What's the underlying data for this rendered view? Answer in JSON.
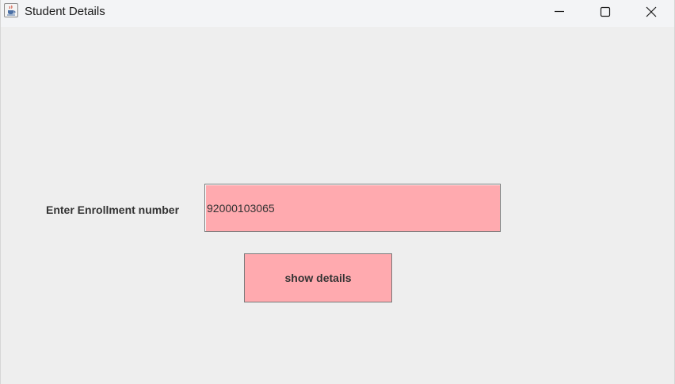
{
  "window": {
    "title": "Student Details",
    "icon": "java-cup-icon",
    "controls": [
      "minimize-icon",
      "maximize-icon",
      "close-icon"
    ]
  },
  "form": {
    "enrollment_label": "Enter Enrollment number",
    "enrollment_value": "92000103065",
    "show_button_label": "show details"
  },
  "colors": {
    "background": "#eeeeee",
    "titlebar": "#f3f4f6",
    "field_fill": "#ffaaaf",
    "text": "#333333"
  }
}
